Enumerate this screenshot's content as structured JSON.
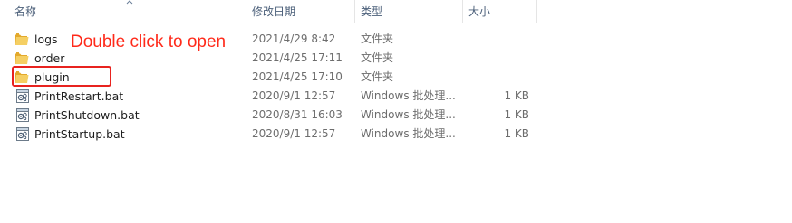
{
  "columns": {
    "name": "名称",
    "date": "修改日期",
    "type": "类型",
    "size": "大小"
  },
  "files": [
    {
      "name": "logs",
      "date": "2021/4/29 8:42",
      "type": "文件夹",
      "size": "",
      "icon": "folder-icon"
    },
    {
      "name": "order",
      "date": "2021/4/25 17:11",
      "type": "文件夹",
      "size": "",
      "icon": "folder-icon"
    },
    {
      "name": "plugin",
      "date": "2021/4/25 17:10",
      "type": "文件夹",
      "size": "",
      "icon": "folder-icon"
    },
    {
      "name": "PrintRestart.bat",
      "date": "2020/9/1 12:57",
      "type": "Windows 批处理...",
      "size": "1 KB",
      "icon": "batch-file-icon"
    },
    {
      "name": "PrintShutdown.bat",
      "date": "2020/8/31 16:03",
      "type": "Windows 批处理...",
      "size": "1 KB",
      "icon": "batch-file-icon"
    },
    {
      "name": "PrintStartup.bat",
      "date": "2020/9/1 12:57",
      "type": "Windows 批处理...",
      "size": "1 KB",
      "icon": "batch-file-icon"
    }
  ],
  "annotation": {
    "text": "Double click to open",
    "color": "#ff2a1a"
  },
  "colors": {
    "header_text": "#4c607a",
    "folder": "#f2c14e",
    "highlight_border": "#e8231f"
  }
}
